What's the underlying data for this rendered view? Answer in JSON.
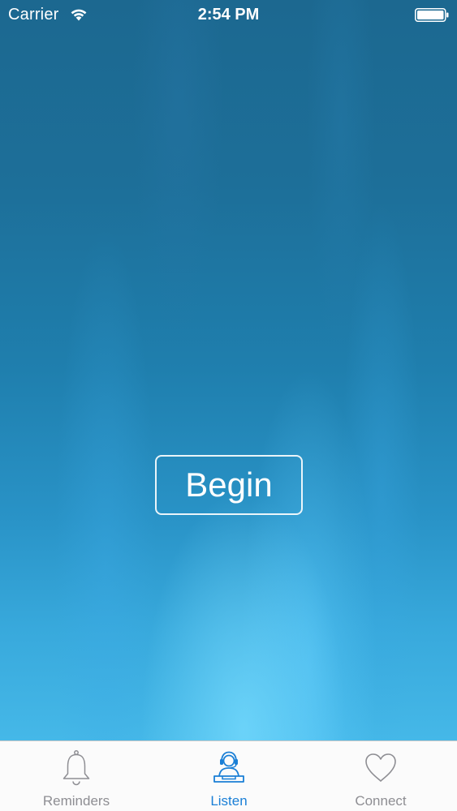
{
  "status_bar": {
    "carrier": "Carrier",
    "time": "2:54 PM",
    "wifi_icon": "wifi-icon",
    "battery_icon": "battery-icon"
  },
  "main": {
    "begin_label": "Begin"
  },
  "tab_bar": {
    "active_color": "#1a7fd6",
    "inactive_color": "#8e8e93",
    "tabs": [
      {
        "label": "Reminders",
        "icon": "bell-icon",
        "active": false
      },
      {
        "label": "Listen",
        "icon": "listener-headset-icon",
        "active": true
      },
      {
        "label": "Connect",
        "icon": "heart-icon",
        "active": false
      }
    ]
  }
}
